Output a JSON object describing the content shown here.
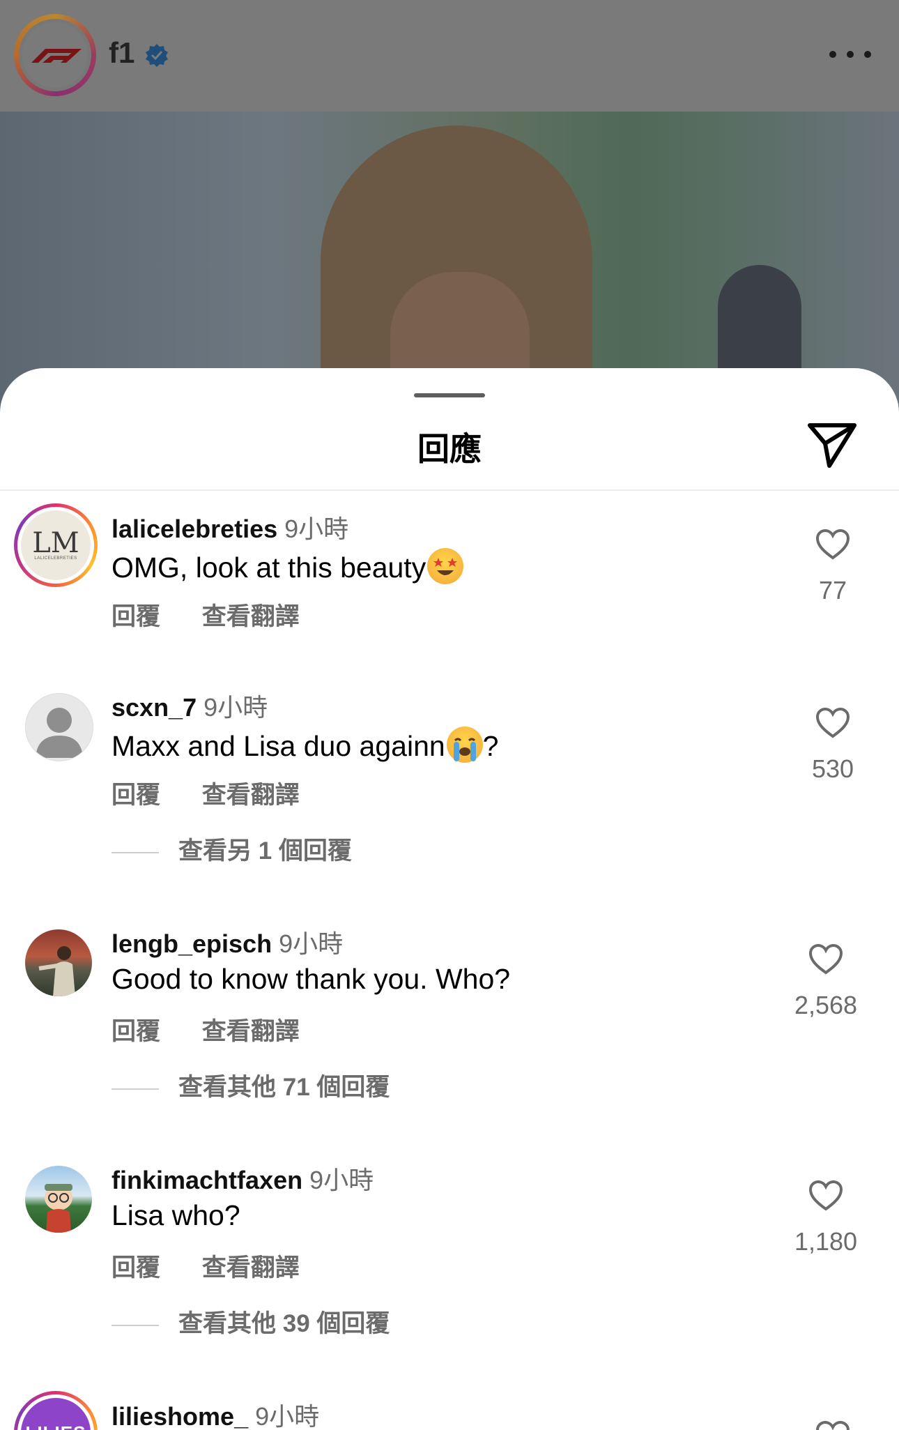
{
  "post": {
    "username": "f1",
    "verified": true
  },
  "sheet": {
    "title": "回應"
  },
  "comments": [
    {
      "username": "lalicelebreties",
      "time": "9小時",
      "text": "OMG, look at this beauty",
      "emoji": "star-struck-emoji",
      "reply_label": "回覆",
      "translate_label": "查看翻譯",
      "likes": "77",
      "more_replies": ""
    },
    {
      "username": "scxn_7",
      "time": "9小時",
      "text": "Maxx and Lisa duo againn",
      "text_suffix": "?",
      "emoji": "crying-emoji",
      "reply_label": "回覆",
      "translate_label": "查看翻譯",
      "likes": "530",
      "more_replies": "查看另 1 個回覆"
    },
    {
      "username": "lengb_episch",
      "time": "9小時",
      "text": "Good to know thank you. Who?",
      "reply_label": "回覆",
      "translate_label": "查看翻譯",
      "likes": "2,568",
      "more_replies": "查看其他 71 個回覆"
    },
    {
      "username": "finkimachtfaxen",
      "time": "9小時",
      "text": "Lisa who?",
      "reply_label": "回覆",
      "translate_label": "查看翻譯",
      "likes": "1,180",
      "more_replies": "查看其他 39 個回覆"
    },
    {
      "username": "lilieshome_",
      "time": "9小時",
      "avatar_text": "LILIES"
    }
  ],
  "avatars": {
    "lalicelebreties_monogram": "LM",
    "lalicelebreties_caption": "LALICELEBRETIES"
  },
  "colors": {
    "story_ring": "#e1306c",
    "verified_blue": "#3897f0",
    "secondary_text": "#6b6b6b"
  }
}
